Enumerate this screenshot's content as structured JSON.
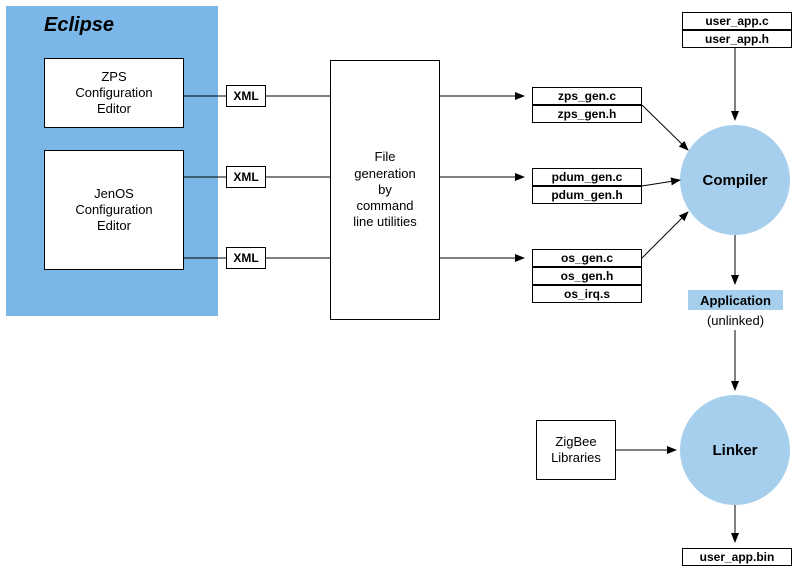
{
  "eclipse": {
    "title": "Eclipse",
    "editors": {
      "zps": "ZPS\nConfiguration\nEditor",
      "jenos": "JenOS\nConfiguration\nEditor"
    }
  },
  "xml_labels": {
    "xml1": "XML",
    "xml2": "XML",
    "xml3": "XML"
  },
  "filegen": "File\ngeneration\nby\ncommand\nline utilities",
  "generated_files": {
    "zps_c": "zps_gen.c",
    "zps_h": "zps_gen.h",
    "pdum_c": "pdum_gen.c",
    "pdum_h": "pdum_gen.h",
    "os_c": "os_gen.c",
    "os_h": "os_gen.h",
    "os_irq": "os_irq.s"
  },
  "user_files": {
    "user_c": "user_app.c",
    "user_h": "user_app.h"
  },
  "compiler": "Compiler",
  "application": {
    "title": "Application",
    "status": "(unlinked)"
  },
  "zigbee": "ZigBee\nLibraries",
  "linker": "Linker",
  "output_file": "user_app.bin"
}
